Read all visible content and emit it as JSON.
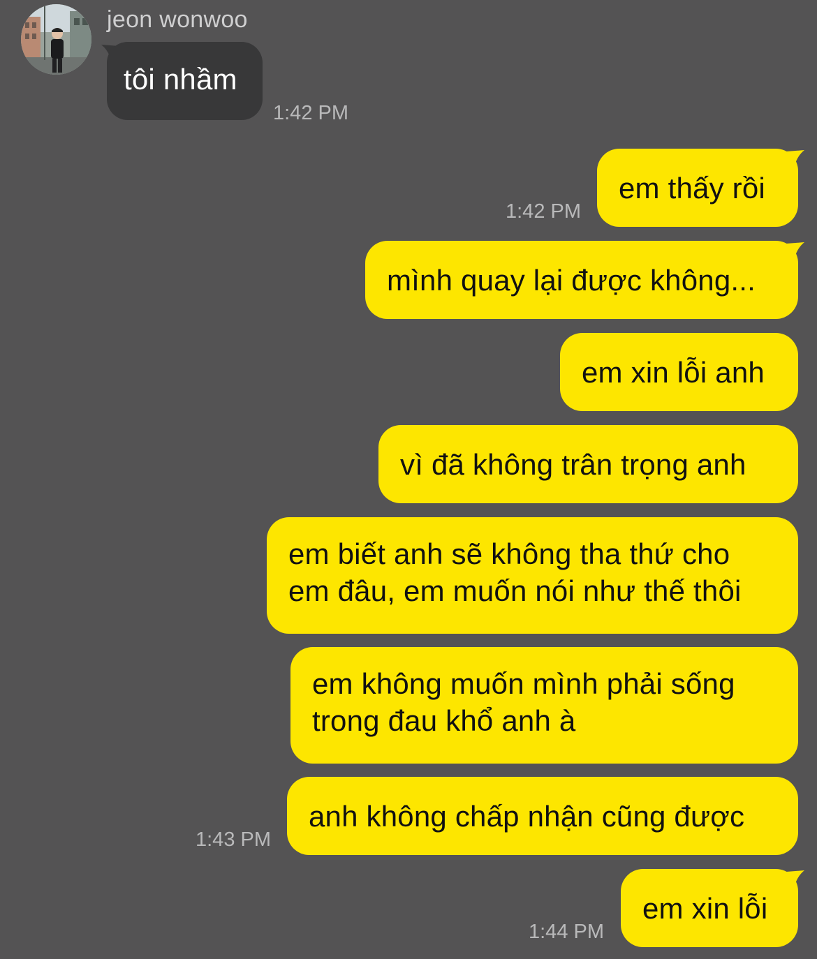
{
  "colors": {
    "background": "#545354",
    "incoming_bubble": "#383839",
    "outgoing_bubble": "#fde600",
    "timestamp": "#b9b9ba"
  },
  "contact": {
    "name": "jeon wonwoo",
    "avatar_icon": "profile-photo"
  },
  "messages": [
    {
      "from": "contact",
      "text": "tôi nhầm",
      "time": "1:42 PM"
    },
    {
      "from": "me",
      "text": "em thấy rồi",
      "time": "1:42 PM"
    },
    {
      "from": "me",
      "text": "mình quay lại được không..."
    },
    {
      "from": "me",
      "text": "em xin lỗi anh"
    },
    {
      "from": "me",
      "text": "vì đã không trân trọng anh"
    },
    {
      "from": "me",
      "lines": [
        "em biết anh sẽ không tha thứ cho",
        "em đâu, em muốn nói như thế thôi"
      ]
    },
    {
      "from": "me",
      "lines": [
        "em không muốn mình phải sống",
        "trong đau khổ anh à"
      ]
    },
    {
      "from": "me",
      "text": "anh không chấp nhận cũng được",
      "time": "1:43 PM"
    },
    {
      "from": "me",
      "text": "em xin lỗi",
      "time": "1:44 PM"
    }
  ]
}
